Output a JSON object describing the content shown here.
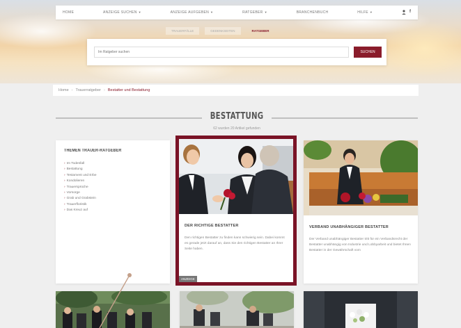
{
  "nav": {
    "items": [
      {
        "label": "HOME",
        "dropdown": false
      },
      {
        "label": "ANZEIGE SUCHEN",
        "dropdown": true
      },
      {
        "label": "ANZEIGE AUFGEBEN",
        "dropdown": true
      },
      {
        "label": "RATGEBER",
        "dropdown": true
      },
      {
        "label": "BRANCHENBUCH",
        "dropdown": false
      },
      {
        "label": "HILFE",
        "dropdown": true
      }
    ],
    "user_icon": "user-icon",
    "facebook_icon": "facebook-icon"
  },
  "subtabs": [
    {
      "label": "TRAUERFÄLLE",
      "active": false
    },
    {
      "label": "GEDENKSEITEN",
      "active": false
    },
    {
      "label": "RATGEBER",
      "active": true
    }
  ],
  "search": {
    "placeholder": "Im Ratgeber suchen",
    "button_label": "SUCHEN"
  },
  "breadcrumb": {
    "items": [
      "Home",
      "Trauerratgeber"
    ],
    "current": "Bestatter und Bestattung",
    "separator": "›"
  },
  "section": {
    "title": "BESTATTUNG",
    "subtitle": "62 wurden 20 Artikel gefunden"
  },
  "sidebar": {
    "title": "THEMEN TRAUER-RATGEBER",
    "items": [
      "Im Todesfall",
      "Bestattung",
      "Testament und Erbe",
      "Kondolieren",
      "Trauersprüche",
      "Vorsorge",
      "Grab und Grabstein",
      "Trauerfloristik",
      "Das Kreuz auf"
    ]
  },
  "articles": [
    {
      "title": "DER RICHTIGE BESTATTER",
      "text": "Den richtigen Bestatter zu finden kann schwierig sein. Dabei kommt es gerade jetzt darauf an, dass Sie den richtigen Bestatter an Ihrer Seite haben.",
      "badge": "ANZEIGE"
    },
    {
      "title": "VERBAND UNABHÄNGIGER BESTATTER",
      "text": "Der Verband unabhängiger Bestatter tritt für ein Verbandsrecht der Bestatter unabhängig von Industrie und Lobbyarbeit und bietet Ihnen Bestatter in der Gewährschaft vom"
    }
  ],
  "colors": {
    "accent": "#8a1c2b",
    "featured_border": "#7a1326"
  }
}
